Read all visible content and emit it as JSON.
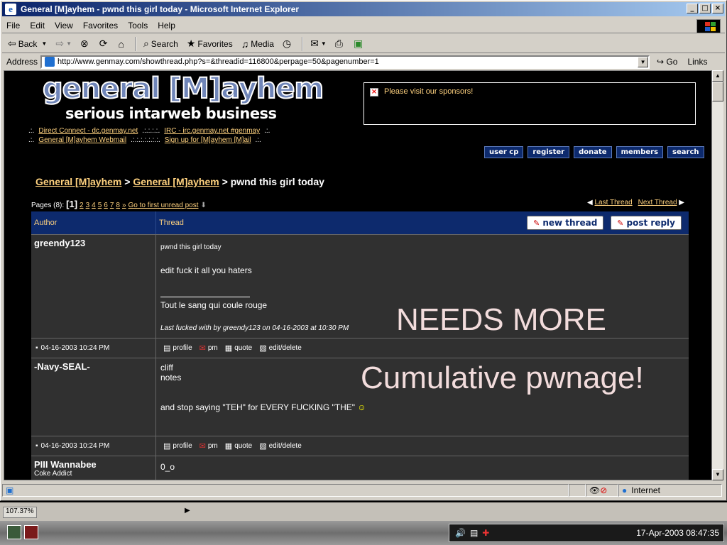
{
  "window": {
    "title": "General [M]ayhem - pwnd this girl today - Microsoft Internet Explorer"
  },
  "menu": [
    "File",
    "Edit",
    "View",
    "Favorites",
    "Tools",
    "Help"
  ],
  "toolbar": {
    "back": "Back",
    "search": "Search",
    "favorites": "Favorites",
    "media": "Media"
  },
  "address": {
    "label": "Address",
    "url": "http://www.genmay.com/showthread.php?s=&threadid=116800&perpage=50&pagenumber=1",
    "go": "Go",
    "links": "Links"
  },
  "site": {
    "logo_title": "general [M]ayhem",
    "logo_subtitle": "serious intarweb business",
    "links_row1": [
      ".:.",
      "Direct Connect - dc.genmay.net",
      ".:.:.:.:.",
      "IRC - irc.genmay.net #genmay",
      ".:."
    ],
    "links_row2": [
      ".:.",
      "General [M]ayhem Webmail",
      ".:.:.:.:.:.:.:.",
      "Sign up for [M]ayhem [M]ail",
      ".:."
    ],
    "sponsor_text": "Please visit our sponsors!",
    "nav_buttons": [
      "user cp",
      "register",
      "donate",
      "members",
      "search"
    ]
  },
  "breadcrumb": {
    "forum1": "General [M]ayhem",
    "sep": ">",
    "forum2": "General [M]ayhem",
    "thread": "pwnd this girl today"
  },
  "pagination": {
    "label": "Pages (8):",
    "current": "[1]",
    "pages": [
      "2",
      "3",
      "4",
      "5",
      "6",
      "7",
      "8",
      "»"
    ],
    "first_unread": "Go to first unread post"
  },
  "thread_nav": {
    "last": "Last Thread",
    "next": "Next Thread"
  },
  "table_header": {
    "author": "Author",
    "thread": "Thread",
    "new_thread": "new thread",
    "post_reply": "post reply"
  },
  "posts": [
    {
      "author": "greendy123",
      "subject": "pwnd this girl today",
      "line1": "edit fuck it all you haters",
      "signature": "Tout le sang qui coule rouge",
      "edit_note": "Last fucked with by greendy123 on 04-16-2003 at 10:30 PM",
      "date": "04-16-2003 10:24 PM"
    },
    {
      "author": "-Navy-SEAL-",
      "line1": "cliff",
      "line2": "notes",
      "line3": "and stop saying \"TEH\" for EVERY FUCKING \"THE\"",
      "date": "04-16-2003 10:24 PM"
    },
    {
      "author": "PIII Wannabee",
      "title": "Coke Addict",
      "line1": "0_o"
    }
  ],
  "post_actions": [
    "profile",
    "pm",
    "quote",
    "edit/delete"
  ],
  "overlays": {
    "needs_more": "NEEDS MORE",
    "cumulative": "Cumulative pwnage!"
  },
  "status": {
    "zone": "Internet",
    "zoom": "107.37%"
  },
  "tray": {
    "clock": "17-Apr-2003 08:47:35"
  }
}
